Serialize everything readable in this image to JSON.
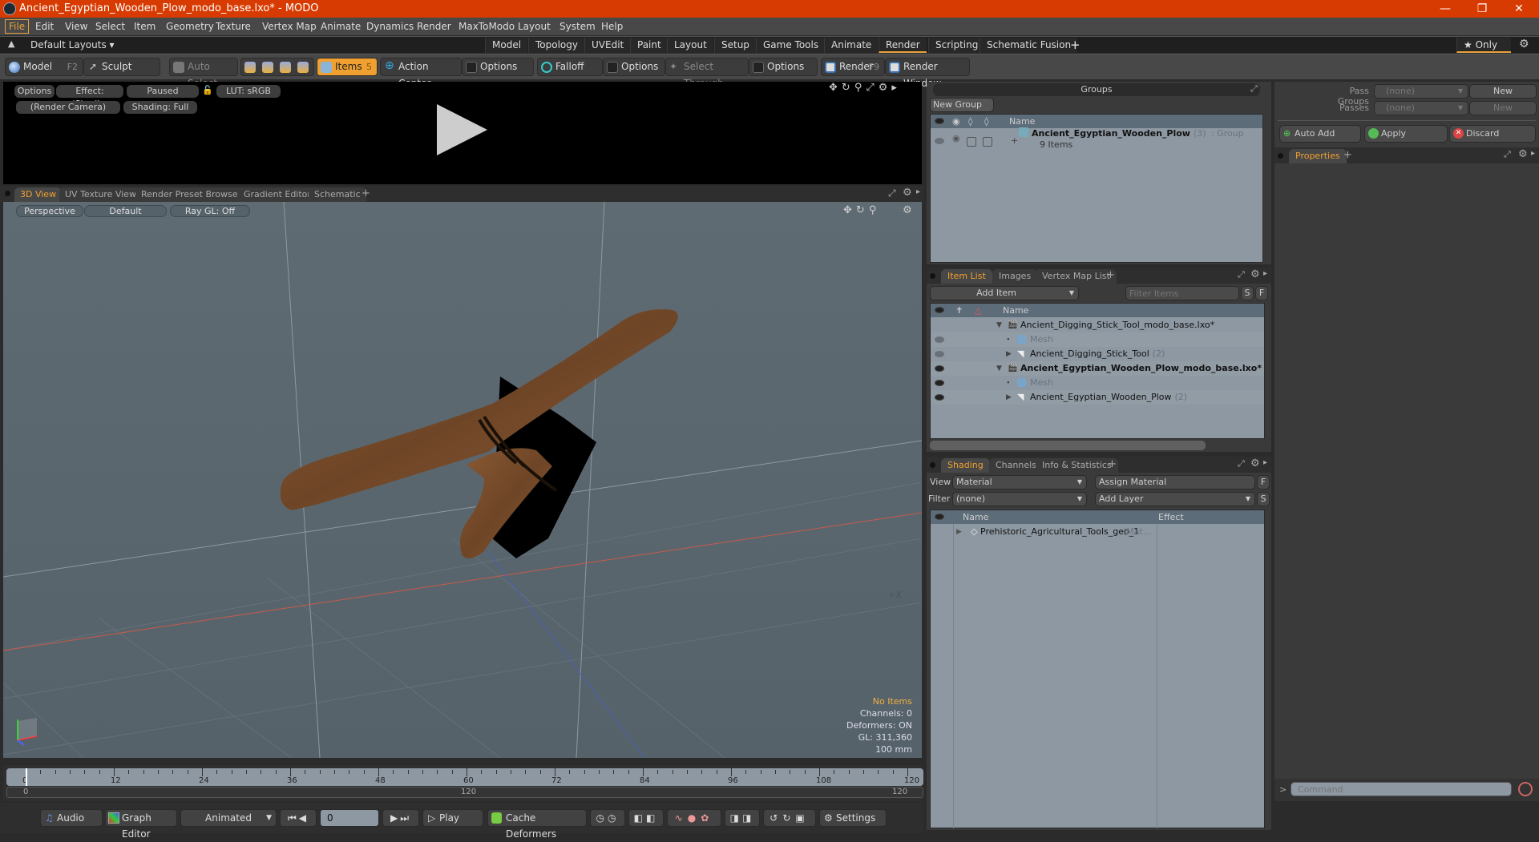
{
  "window": {
    "title": "Ancient_Egyptian_Wooden_Plow_modo_base.lxo* - MODO",
    "controls": [
      "minimize",
      "restore",
      "close"
    ]
  },
  "menu": [
    "File",
    "Edit",
    "View",
    "Select",
    "Item",
    "Geometry",
    "Texture",
    "Vertex Map",
    "Animate",
    "Dynamics",
    "Render",
    "MaxToModo",
    "Layout",
    "System",
    "Help"
  ],
  "layout_bar": {
    "layouts_label": "Default Layouts ▾",
    "tabs": [
      "Model",
      "Topology",
      "UVEdit",
      "Paint",
      "Layout",
      "Setup",
      "Game Tools",
      "Animate",
      "Render",
      "Scripting",
      "Schematic Fusion"
    ],
    "active_tab": "Render",
    "add": "+",
    "only_label": "★ Only"
  },
  "toolbar": {
    "model": "Model",
    "model_key": "F2",
    "sculpt": "Sculpt",
    "auto_select": "Auto Select",
    "items": "Items",
    "items_key": "5",
    "action_center": "Action Center",
    "options1": "Options",
    "falloff": "Falloff",
    "options2": "Options",
    "select_through": "Select Through",
    "options3": "Options",
    "render": "Render",
    "render_key": "F9",
    "render_window": "Render Window"
  },
  "render_panel": {
    "options": "Options",
    "effect": "Effect: (Shadi...",
    "paused": "Paused",
    "lut": "LUT: sRGB",
    "camera": "(Render Camera)",
    "shading": "Shading: Full"
  },
  "viewport_tabs": [
    "3D View",
    "UV Texture View",
    "Render Preset Browser",
    "Gradient Editor",
    "Schematic"
  ],
  "viewport": {
    "perspective": "Perspective",
    "default": "Default",
    "raygl": "Ray GL: Off",
    "axis_hint": "+X",
    "info": {
      "selection": "No Items",
      "channels": "Channels: 0",
      "deformers": "Deformers: ON",
      "gl": "GL: 311,360",
      "unit": "100 mm"
    }
  },
  "timeline": {
    "ticks": [
      "0",
      "12",
      "24",
      "36",
      "48",
      "60",
      "72",
      "84",
      "96",
      "108",
      "120"
    ],
    "range_start": "0",
    "range_mid": "120",
    "range_end": "120",
    "current_frame": "0"
  },
  "transport": {
    "audio": "Audio",
    "graph_editor": "Graph Editor",
    "animated": "Animated",
    "play": "Play",
    "cache_deformers": "Cache Deformers",
    "settings": "Settings"
  },
  "groups_panel": {
    "title": "Groups",
    "new_group": "New Group",
    "col_name": "Name",
    "group_name": "Ancient_Egyptian_Wooden_Plow",
    "group_count": "(3)",
    "group_type": ": Group",
    "group_items": "9 Items"
  },
  "pass_panel": {
    "pass_groups_label": "Pass Groups",
    "pass_groups_value": "(none)",
    "passes_label": "Passes",
    "passes_value": "(none)",
    "new": "New",
    "auto_add": "Auto Add",
    "apply": "Apply",
    "discard": "Discard",
    "properties_tab": "Properties"
  },
  "item_list": {
    "tabs": [
      "Item List",
      "Images",
      "Vertex Map List"
    ],
    "add_item": "Add Item",
    "filter_placeholder": "Filter Items",
    "s": "S",
    "f": "F",
    "col_name": "Name",
    "rows": [
      {
        "name": "Ancient_Digging_Stick_Tool_modo_base.lxo*",
        "count": "",
        "type": "scene",
        "bold": false,
        "indent": 0
      },
      {
        "name": "Mesh",
        "count": "",
        "type": "mesh",
        "bold": false,
        "indent": 1
      },
      {
        "name": "Ancient_Digging_Stick_Tool",
        "count": "(2)",
        "type": "group",
        "bold": false,
        "indent": 1
      },
      {
        "name": "Ancient_Egyptian_Wooden_Plow_modo_base.lxo*",
        "count": "",
        "type": "scene",
        "bold": true,
        "indent": 0
      },
      {
        "name": "Mesh",
        "count": "",
        "type": "mesh",
        "bold": false,
        "indent": 1
      },
      {
        "name": "Ancient_Egyptian_Wooden_Plow",
        "count": "(2)",
        "type": "group",
        "bold": false,
        "indent": 1
      }
    ]
  },
  "shading": {
    "tabs": [
      "Shading",
      "Channels",
      "Info & Statistics"
    ],
    "view_label": "View",
    "view_value": "Material",
    "assign_material": "Assign Material",
    "filter_label": "Filter",
    "filter_value": "(none)",
    "add_layer": "Add Layer",
    "f": "F",
    "s": "S",
    "col_name": "Name",
    "col_effect": "Effect",
    "rows": [
      {
        "name": "Prehistoric_Agricultural_Tools_geo_1",
        "suffix": "(Mat..."
      }
    ]
  },
  "command": {
    "placeholder": "Command",
    "prompt": ">"
  }
}
